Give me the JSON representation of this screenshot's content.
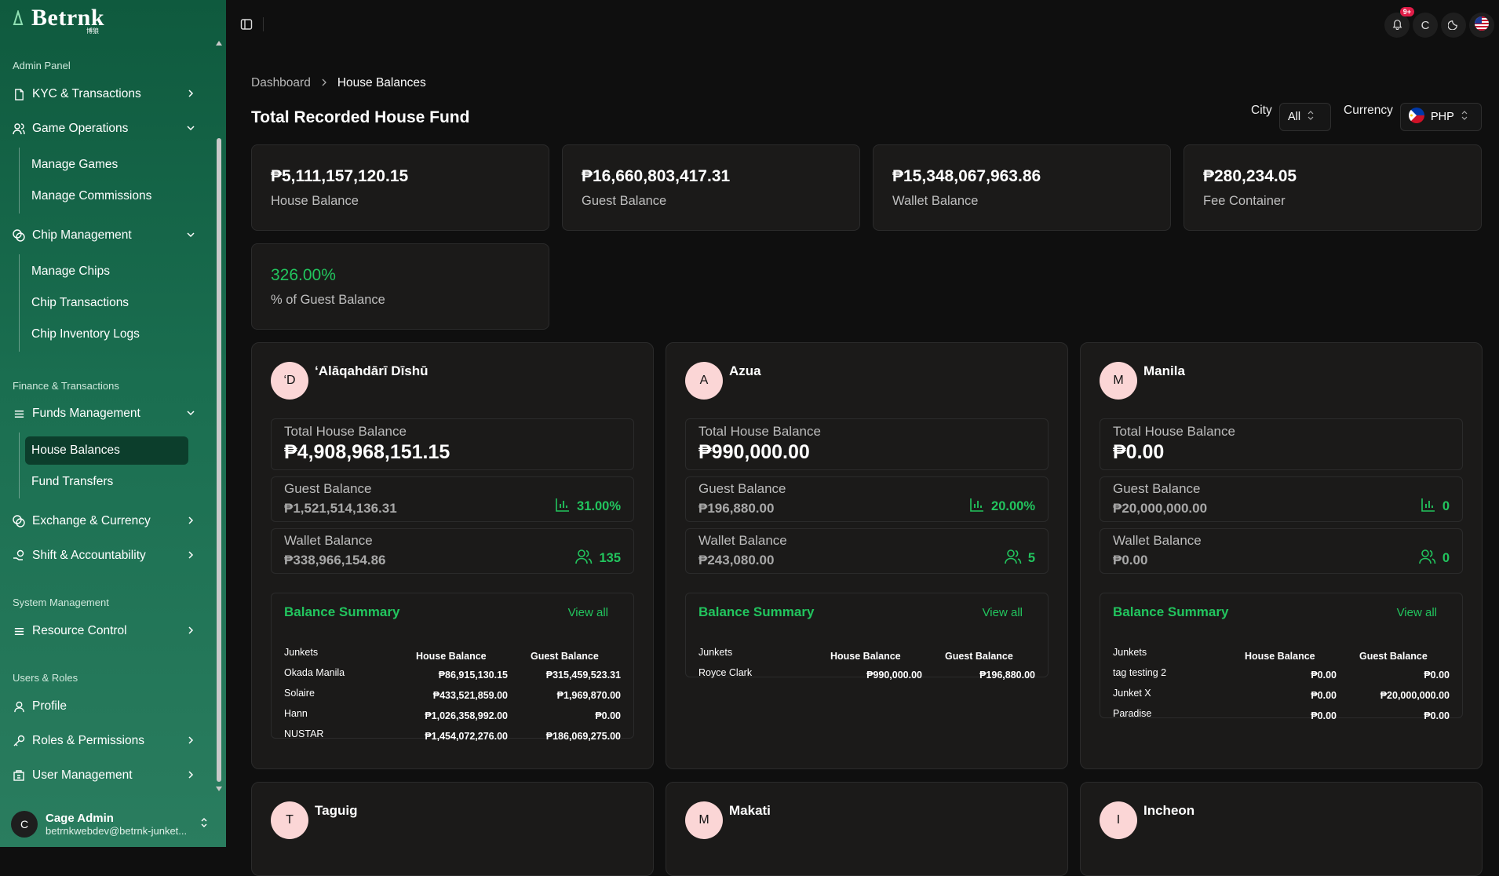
{
  "app": {
    "brand": "Betrnk",
    "brand_sub": "博狼"
  },
  "sidebar": {
    "sections": {
      "admin": "Admin Panel",
      "finance": "Finance & Transactions",
      "system": "System Management",
      "users": "Users & Roles"
    },
    "kyc": "KYC & Transactions",
    "game_ops": "Game Operations",
    "manage_games": "Manage Games",
    "manage_commissions": "Manage Commissions",
    "chip_mgmt": "Chip Management",
    "manage_chips": "Manage Chips",
    "chip_transactions": "Chip Transactions",
    "chip_inventory_logs": "Chip Inventory Logs",
    "funds_mgmt": "Funds Management",
    "house_balances": "House Balances",
    "fund_transfers": "Fund Transfers",
    "exchange_currency": "Exchange & Currency",
    "shift_accountability": "Shift & Accountability",
    "resource_control": "Resource Control",
    "profile": "Profile",
    "roles_permissions": "Roles & Permissions",
    "user_management": "User Management"
  },
  "user": {
    "initial": "C",
    "name": "Cage Admin",
    "email": "betrnkwebdev@betrnk-junket..."
  },
  "topbar": {
    "notif_badge": "9+",
    "avatar_initial": "C"
  },
  "breadcrumb": {
    "parent": "Dashboard",
    "current": "House Balances"
  },
  "page": {
    "title": "Total Recorded House Fund"
  },
  "filters": {
    "city_label": "City",
    "city_value": "All",
    "currency_label": "Currency",
    "currency_value": "PHP"
  },
  "stats": [
    {
      "value": "₱5,111,157,120.15",
      "label": "House Balance"
    },
    {
      "value": "₱16,660,803,417.31",
      "label": "Guest Balance"
    },
    {
      "value": "₱15,348,067,963.86",
      "label": "Wallet Balance"
    },
    {
      "value": "₱280,234.05",
      "label": "Fee Container"
    },
    {
      "value": "326.00%",
      "label": "% of Guest Balance"
    }
  ],
  "labels": {
    "total_house": "Total House Balance",
    "guest": "Guest Balance",
    "wallet": "Wallet Balance",
    "summary": "Balance Summary",
    "view_all": "View all",
    "junkets": "Junkets",
    "house_col": "House Balance",
    "guest_col": "Guest Balance"
  },
  "cities": [
    {
      "initial": "‘D",
      "name": "‘Alāqahdārī Dīshū",
      "total": "₱4,908,968,151.15",
      "guest": "₱1,521,514,136.31",
      "guest_pct": "31.00%",
      "wallet": "₱338,966,154.86",
      "users": "135",
      "rows": [
        {
          "name": "Okada Manila",
          "house": "₱86,915,130.15",
          "guest": "₱315,459,523.31"
        },
        {
          "name": "Solaire",
          "house": "₱433,521,859.00",
          "guest": "₱1,969,870.00"
        },
        {
          "name": "Hann",
          "house": "₱1,026,358,992.00",
          "guest": "₱0.00"
        },
        {
          "name": "NUSTAR",
          "house": "₱1,454,072,276.00",
          "guest": "₱186,069,275.00"
        }
      ]
    },
    {
      "initial": "A",
      "name": "Azua",
      "total": "₱990,000.00",
      "guest": "₱196,880.00",
      "guest_pct": "20.00%",
      "wallet": "₱243,080.00",
      "users": "5",
      "rows": [
        {
          "name": "Royce Clark",
          "house": "₱990,000.00",
          "guest": "₱196,880.00"
        }
      ]
    },
    {
      "initial": "M",
      "name": "Manila",
      "total": "₱0.00",
      "guest": "₱20,000,000.00",
      "guest_pct": "0",
      "wallet": "₱0.00",
      "users": "0",
      "rows": [
        {
          "name": "tag testing 2",
          "house": "₱0.00",
          "guest": "₱0.00"
        },
        {
          "name": "Junket X",
          "house": "₱0.00",
          "guest": "₱20,000,000.00"
        },
        {
          "name": "Paradise",
          "house": "₱0.00",
          "guest": "₱0.00"
        }
      ]
    },
    {
      "initial": "T",
      "name": "Taguig"
    },
    {
      "initial": "M",
      "name": "Makati"
    },
    {
      "initial": "I",
      "name": "Incheon"
    }
  ],
  "colors": {
    "accent": "#22c55e",
    "sidebar_top": "#0f5a3e",
    "bg": "#0f0f0f",
    "card": "#1b1a19",
    "avatar": "#fbd6d6"
  }
}
